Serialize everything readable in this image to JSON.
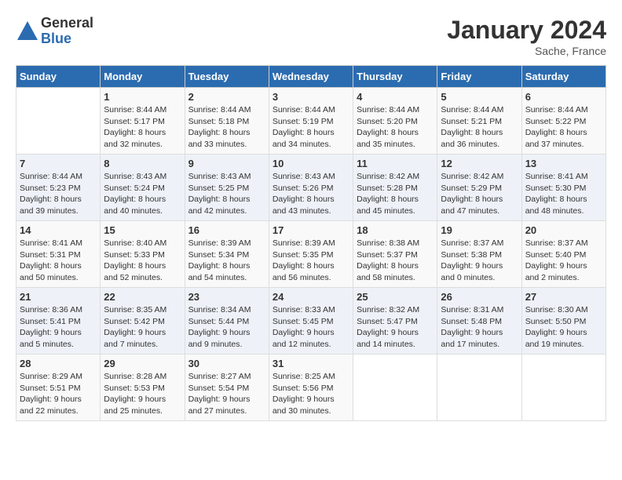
{
  "logo": {
    "general": "General",
    "blue": "Blue"
  },
  "title": "January 2024",
  "location": "Sache, France",
  "days_header": [
    "Sunday",
    "Monday",
    "Tuesday",
    "Wednesday",
    "Thursday",
    "Friday",
    "Saturday"
  ],
  "weeks": [
    [
      {
        "day": "",
        "content": ""
      },
      {
        "day": "1",
        "content": "Sunrise: 8:44 AM\nSunset: 5:17 PM\nDaylight: 8 hours\nand 32 minutes."
      },
      {
        "day": "2",
        "content": "Sunrise: 8:44 AM\nSunset: 5:18 PM\nDaylight: 8 hours\nand 33 minutes."
      },
      {
        "day": "3",
        "content": "Sunrise: 8:44 AM\nSunset: 5:19 PM\nDaylight: 8 hours\nand 34 minutes."
      },
      {
        "day": "4",
        "content": "Sunrise: 8:44 AM\nSunset: 5:20 PM\nDaylight: 8 hours\nand 35 minutes."
      },
      {
        "day": "5",
        "content": "Sunrise: 8:44 AM\nSunset: 5:21 PM\nDaylight: 8 hours\nand 36 minutes."
      },
      {
        "day": "6",
        "content": "Sunrise: 8:44 AM\nSunset: 5:22 PM\nDaylight: 8 hours\nand 37 minutes."
      }
    ],
    [
      {
        "day": "7",
        "content": "Sunrise: 8:44 AM\nSunset: 5:23 PM\nDaylight: 8 hours\nand 39 minutes."
      },
      {
        "day": "8",
        "content": "Sunrise: 8:43 AM\nSunset: 5:24 PM\nDaylight: 8 hours\nand 40 minutes."
      },
      {
        "day": "9",
        "content": "Sunrise: 8:43 AM\nSunset: 5:25 PM\nDaylight: 8 hours\nand 42 minutes."
      },
      {
        "day": "10",
        "content": "Sunrise: 8:43 AM\nSunset: 5:26 PM\nDaylight: 8 hours\nand 43 minutes."
      },
      {
        "day": "11",
        "content": "Sunrise: 8:42 AM\nSunset: 5:28 PM\nDaylight: 8 hours\nand 45 minutes."
      },
      {
        "day": "12",
        "content": "Sunrise: 8:42 AM\nSunset: 5:29 PM\nDaylight: 8 hours\nand 47 minutes."
      },
      {
        "day": "13",
        "content": "Sunrise: 8:41 AM\nSunset: 5:30 PM\nDaylight: 8 hours\nand 48 minutes."
      }
    ],
    [
      {
        "day": "14",
        "content": "Sunrise: 8:41 AM\nSunset: 5:31 PM\nDaylight: 8 hours\nand 50 minutes."
      },
      {
        "day": "15",
        "content": "Sunrise: 8:40 AM\nSunset: 5:33 PM\nDaylight: 8 hours\nand 52 minutes."
      },
      {
        "day": "16",
        "content": "Sunrise: 8:39 AM\nSunset: 5:34 PM\nDaylight: 8 hours\nand 54 minutes."
      },
      {
        "day": "17",
        "content": "Sunrise: 8:39 AM\nSunset: 5:35 PM\nDaylight: 8 hours\nand 56 minutes."
      },
      {
        "day": "18",
        "content": "Sunrise: 8:38 AM\nSunset: 5:37 PM\nDaylight: 8 hours\nand 58 minutes."
      },
      {
        "day": "19",
        "content": "Sunrise: 8:37 AM\nSunset: 5:38 PM\nDaylight: 9 hours\nand 0 minutes."
      },
      {
        "day": "20",
        "content": "Sunrise: 8:37 AM\nSunset: 5:40 PM\nDaylight: 9 hours\nand 2 minutes."
      }
    ],
    [
      {
        "day": "21",
        "content": "Sunrise: 8:36 AM\nSunset: 5:41 PM\nDaylight: 9 hours\nand 5 minutes."
      },
      {
        "day": "22",
        "content": "Sunrise: 8:35 AM\nSunset: 5:42 PM\nDaylight: 9 hours\nand 7 minutes."
      },
      {
        "day": "23",
        "content": "Sunrise: 8:34 AM\nSunset: 5:44 PM\nDaylight: 9 hours\nand 9 minutes."
      },
      {
        "day": "24",
        "content": "Sunrise: 8:33 AM\nSunset: 5:45 PM\nDaylight: 9 hours\nand 12 minutes."
      },
      {
        "day": "25",
        "content": "Sunrise: 8:32 AM\nSunset: 5:47 PM\nDaylight: 9 hours\nand 14 minutes."
      },
      {
        "day": "26",
        "content": "Sunrise: 8:31 AM\nSunset: 5:48 PM\nDaylight: 9 hours\nand 17 minutes."
      },
      {
        "day": "27",
        "content": "Sunrise: 8:30 AM\nSunset: 5:50 PM\nDaylight: 9 hours\nand 19 minutes."
      }
    ],
    [
      {
        "day": "28",
        "content": "Sunrise: 8:29 AM\nSunset: 5:51 PM\nDaylight: 9 hours\nand 22 minutes."
      },
      {
        "day": "29",
        "content": "Sunrise: 8:28 AM\nSunset: 5:53 PM\nDaylight: 9 hours\nand 25 minutes."
      },
      {
        "day": "30",
        "content": "Sunrise: 8:27 AM\nSunset: 5:54 PM\nDaylight: 9 hours\nand 27 minutes."
      },
      {
        "day": "31",
        "content": "Sunrise: 8:25 AM\nSunset: 5:56 PM\nDaylight: 9 hours\nand 30 minutes."
      },
      {
        "day": "",
        "content": ""
      },
      {
        "day": "",
        "content": ""
      },
      {
        "day": "",
        "content": ""
      }
    ]
  ]
}
